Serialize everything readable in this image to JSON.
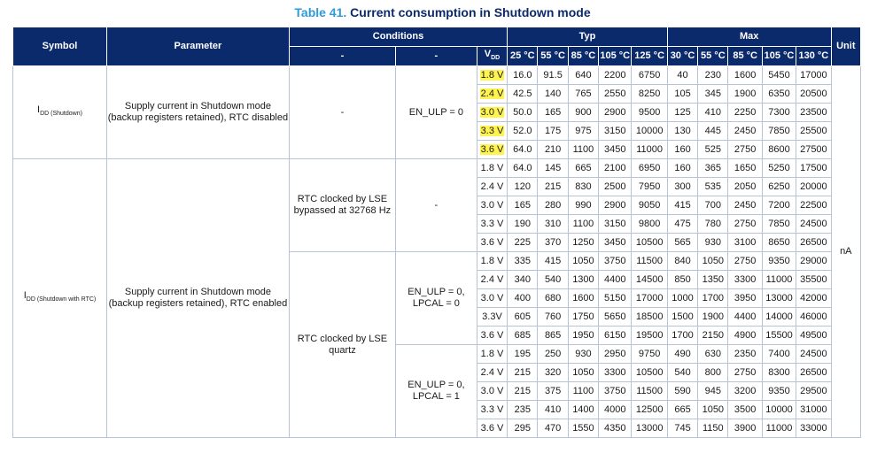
{
  "caption": {
    "label": "Table 41.",
    "title": "Current consumption in Shutdown mode"
  },
  "colors": {
    "header_bg": "#0b2a6b",
    "caption_label": "#2d9bd8",
    "highlight": "#fff44f",
    "border": "#b9c3d6"
  },
  "headers": {
    "symbol": "Symbol",
    "parameter": "Parameter",
    "conditions": "Conditions",
    "typ": "Typ",
    "max": "Max",
    "unit": "Unit",
    "cond_dash1": "-",
    "cond_dash2": "-",
    "vdd_main": "V",
    "vdd_sub": "DD",
    "temps": [
      "25 °C",
      "55 °C",
      "85 °C",
      "105 °C",
      "125 °C",
      "30 °C",
      "55 °C",
      "85 °C",
      "105 °C",
      "130 °C"
    ]
  },
  "groups": [
    {
      "symbol_main": "I",
      "symbol_sub": "DD (Shutdown)",
      "parameter": "Supply current in Shutdown mode (backup registers retained), RTC disabled",
      "rtc": "-",
      "cond": "EN_ULP = 0",
      "rows": [
        {
          "vdd": "1.8 V",
          "typ": [
            "16.0",
            "91.5",
            "640",
            "2200",
            "6750"
          ],
          "max": [
            "40",
            "230",
            "1600",
            "5450",
            "17000"
          ]
        },
        {
          "vdd": "2.4 V",
          "typ": [
            "42.5",
            "140",
            "765",
            "2550",
            "8250"
          ],
          "max": [
            "105",
            "345",
            "1900",
            "6350",
            "20500"
          ]
        },
        {
          "vdd": "3.0 V",
          "typ": [
            "50.0",
            "165",
            "900",
            "2900",
            "9500"
          ],
          "max": [
            "125",
            "410",
            "2250",
            "7300",
            "23500"
          ]
        },
        {
          "vdd": "3.3 V",
          "typ": [
            "52.0",
            "175",
            "975",
            "3150",
            "10000"
          ],
          "max": [
            "130",
            "445",
            "2450",
            "7850",
            "25500"
          ]
        },
        {
          "vdd": "3.6 V",
          "typ": [
            "64.0",
            "210",
            "1100",
            "3450",
            "11000"
          ],
          "max": [
            "160",
            "525",
            "2750",
            "8600",
            "27500"
          ]
        }
      ]
    },
    {
      "symbol_main": "I",
      "symbol_sub": "DD (Shutdown with RTC)",
      "parameter": "Supply current in Shutdown mode (backup registers retained), RTC enabled",
      "rtc_lse_bypass": "RTC clocked by LSE bypassed at 32768 Hz",
      "cond_bypass": "-",
      "rtc_lse_quartz": "RTC clocked by LSE quartz",
      "cond_lpcal0": "EN_ULP = 0, LPCAL = 0",
      "cond_lpcal1": "EN_ULP = 0, LPCAL = 1",
      "rows_bypass": [
        {
          "vdd": "1.8 V",
          "typ": [
            "64.0",
            "145",
            "665",
            "2100",
            "6950"
          ],
          "max": [
            "160",
            "365",
            "1650",
            "5250",
            "17500"
          ]
        },
        {
          "vdd": "2.4 V",
          "typ": [
            "120",
            "215",
            "830",
            "2500",
            "7950"
          ],
          "max": [
            "300",
            "535",
            "2050",
            "6250",
            "20000"
          ]
        },
        {
          "vdd": "3.0 V",
          "typ": [
            "165",
            "280",
            "990",
            "2900",
            "9050"
          ],
          "max": [
            "415",
            "700",
            "2450",
            "7200",
            "22500"
          ]
        },
        {
          "vdd": "3.3 V",
          "typ": [
            "190",
            "310",
            "1100",
            "3150",
            "9800"
          ],
          "max": [
            "475",
            "780",
            "2750",
            "7850",
            "24500"
          ]
        },
        {
          "vdd": "3.6 V",
          "typ": [
            "225",
            "370",
            "1250",
            "3450",
            "10500"
          ],
          "max": [
            "565",
            "930",
            "3100",
            "8650",
            "26500"
          ]
        }
      ],
      "rows_lpcal0": [
        {
          "vdd": "1.8 V",
          "typ": [
            "335",
            "415",
            "1050",
            "3750",
            "11500"
          ],
          "max": [
            "840",
            "1050",
            "2750",
            "9350",
            "29000"
          ]
        },
        {
          "vdd": "2.4 V",
          "typ": [
            "340",
            "540",
            "1300",
            "4400",
            "14500"
          ],
          "max": [
            "850",
            "1350",
            "3300",
            "11000",
            "35500"
          ]
        },
        {
          "vdd": "3.0 V",
          "typ": [
            "400",
            "680",
            "1600",
            "5150",
            "17000"
          ],
          "max": [
            "1000",
            "1700",
            "3950",
            "13000",
            "42000"
          ]
        },
        {
          "vdd": "3.3V",
          "typ": [
            "605",
            "760",
            "1750",
            "5650",
            "18500"
          ],
          "max": [
            "1500",
            "1900",
            "4400",
            "14000",
            "46000"
          ]
        },
        {
          "vdd": "3.6 V",
          "typ": [
            "685",
            "865",
            "1950",
            "6150",
            "19500"
          ],
          "max": [
            "1700",
            "2150",
            "4900",
            "15500",
            "49500"
          ]
        }
      ],
      "rows_lpcal1": [
        {
          "vdd": "1.8 V",
          "typ": [
            "195",
            "250",
            "930",
            "2950",
            "9750"
          ],
          "max": [
            "490",
            "630",
            "2350",
            "7400",
            "24500"
          ]
        },
        {
          "vdd": "2.4 V",
          "typ": [
            "215",
            "320",
            "1050",
            "3300",
            "10500"
          ],
          "max": [
            "540",
            "800",
            "2750",
            "8300",
            "26500"
          ]
        },
        {
          "vdd": "3.0 V",
          "typ": [
            "215",
            "375",
            "1100",
            "3750",
            "11500"
          ],
          "max": [
            "590",
            "945",
            "3200",
            "9350",
            "29500"
          ]
        },
        {
          "vdd": "3.3 V",
          "typ": [
            "235",
            "410",
            "1400",
            "4000",
            "12500"
          ],
          "max": [
            "665",
            "1050",
            "3500",
            "10000",
            "31000"
          ]
        },
        {
          "vdd": "3.6 V",
          "typ": [
            "295",
            "470",
            "1550",
            "4350",
            "13000"
          ],
          "max": [
            "745",
            "1150",
            "3900",
            "11000",
            "33000"
          ]
        }
      ]
    }
  ],
  "unit": "nA"
}
